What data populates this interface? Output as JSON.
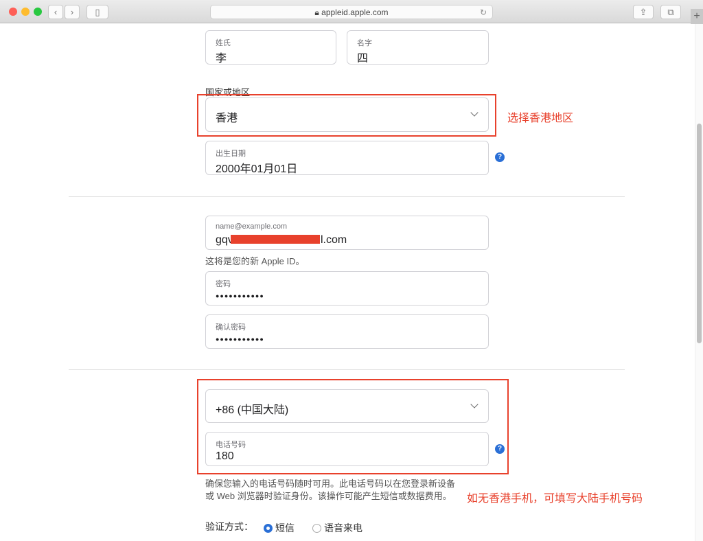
{
  "browser": {
    "url": "appleid.apple.com"
  },
  "form": {
    "last_name": {
      "label": "姓氏",
      "value": "李"
    },
    "first_name": {
      "label": "名字",
      "value": "四"
    },
    "country_label": "国家或地区",
    "country": {
      "value": "香港"
    },
    "birthday": {
      "label": "出生日期",
      "value": "2000年01月01日"
    },
    "email": {
      "label": "name@example.com",
      "value_prefix": "gqv",
      "value_suffix": "l.com"
    },
    "email_hint": "这将是您的新 Apple ID。",
    "password": {
      "label": "密码",
      "value": "●●●●●●●●●●●"
    },
    "confirm_password": {
      "label": "确认密码",
      "value": "●●●●●●●●●●●"
    },
    "phone_country": {
      "value": "+86 (中国大陆)"
    },
    "phone": {
      "label": "电话号码",
      "value": "180"
    },
    "phone_desc_1": "确保您输入的电话号码随时可用。此电话号码以在您登录新设备",
    "phone_desc_2": "或 Web 浏览器时验证身份。该操作可能产生短信或数据费用。",
    "verify_label": "验证方式：",
    "verify_options": [
      {
        "label": "短信",
        "selected": true
      },
      {
        "label": "语音来电",
        "selected": false
      }
    ],
    "help": "?"
  },
  "annotations": {
    "region": "选择香港地区",
    "phone": "如无香港手机，可填写大陆手机号码"
  },
  "colors": {
    "annotation": "#e8412c",
    "accent": "#2a6fd6"
  }
}
